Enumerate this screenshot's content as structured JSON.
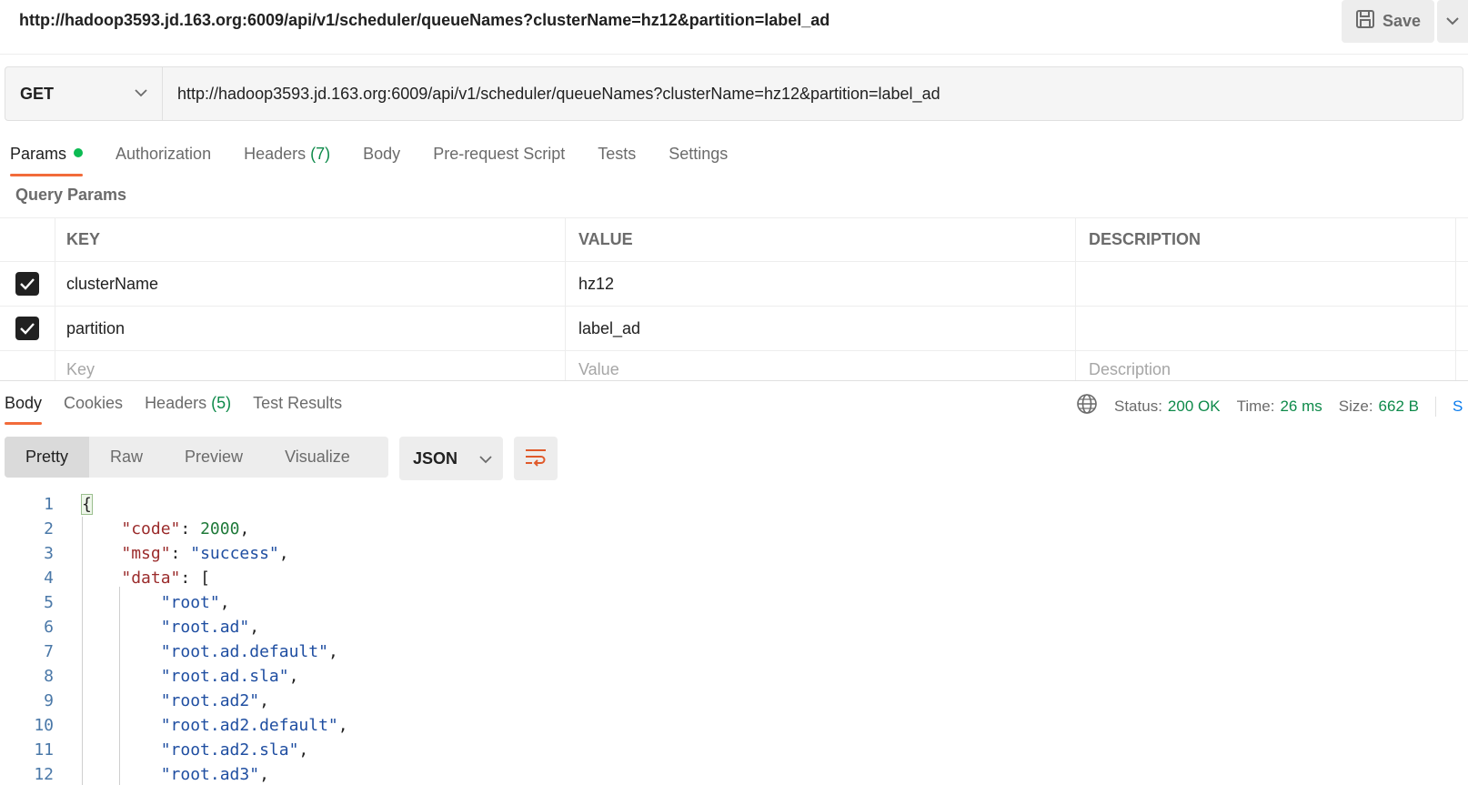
{
  "title_url": "http://hadoop3593.jd.163.org:6009/api/v1/scheduler/queueNames?clusterName=hz12&partition=label_ad",
  "save_label": "Save",
  "request": {
    "method": "GET",
    "url": "http://hadoop3593.jd.163.org:6009/api/v1/scheduler/queueNames?clusterName=hz12&partition=label_ad"
  },
  "request_tabs": {
    "params": "Params",
    "authorization": "Authorization",
    "headers": "Headers",
    "headers_count": "(7)",
    "body": "Body",
    "prerequest": "Pre-request Script",
    "tests": "Tests",
    "settings": "Settings"
  },
  "query_params_title": "Query Params",
  "params_table": {
    "headers": {
      "key": "KEY",
      "value": "VALUE",
      "description": "DESCRIPTION"
    },
    "rows": [
      {
        "key": "clusterName",
        "value": "hz12",
        "description": ""
      },
      {
        "key": "partition",
        "value": "label_ad",
        "description": ""
      }
    ],
    "placeholders": {
      "key": "Key",
      "value": "Value",
      "description": "Description"
    }
  },
  "response_tabs": {
    "body": "Body",
    "cookies": "Cookies",
    "headers": "Headers",
    "headers_count": "(5)",
    "test_results": "Test Results"
  },
  "status": {
    "status_label": "Status:",
    "status_value": "200 OK",
    "time_label": "Time:",
    "time_value": "26 ms",
    "size_label": "Size:",
    "size_value": "662 B",
    "trailing": "S"
  },
  "view_modes": {
    "pretty": "Pretty",
    "raw": "Raw",
    "preview": "Preview",
    "visualize": "Visualize"
  },
  "language": "JSON",
  "code_lines": {
    "l1": "1",
    "l2": "2",
    "l3": "3",
    "l4": "4",
    "l5": "5",
    "l6": "6",
    "l7": "7",
    "l8": "8",
    "l9": "9",
    "l10": "10",
    "l11": "11",
    "l12": "12",
    "open_brace": "{",
    "code_key": "\"code\"",
    "code_val": "2000",
    "msg_key": "\"msg\"",
    "msg_val": "\"success\"",
    "data_key": "\"data\"",
    "data_open": "[",
    "items": [
      "\"root\"",
      "\"root.ad\"",
      "\"root.ad.default\"",
      "\"root.ad.sla\"",
      "\"root.ad2\"",
      "\"root.ad2.default\"",
      "\"root.ad2.sla\"",
      "\"root.ad3\""
    ]
  },
  "colors": {
    "accent": "#f26b3a",
    "success": "#0e8a4a",
    "dot": "#0cbb52"
  }
}
